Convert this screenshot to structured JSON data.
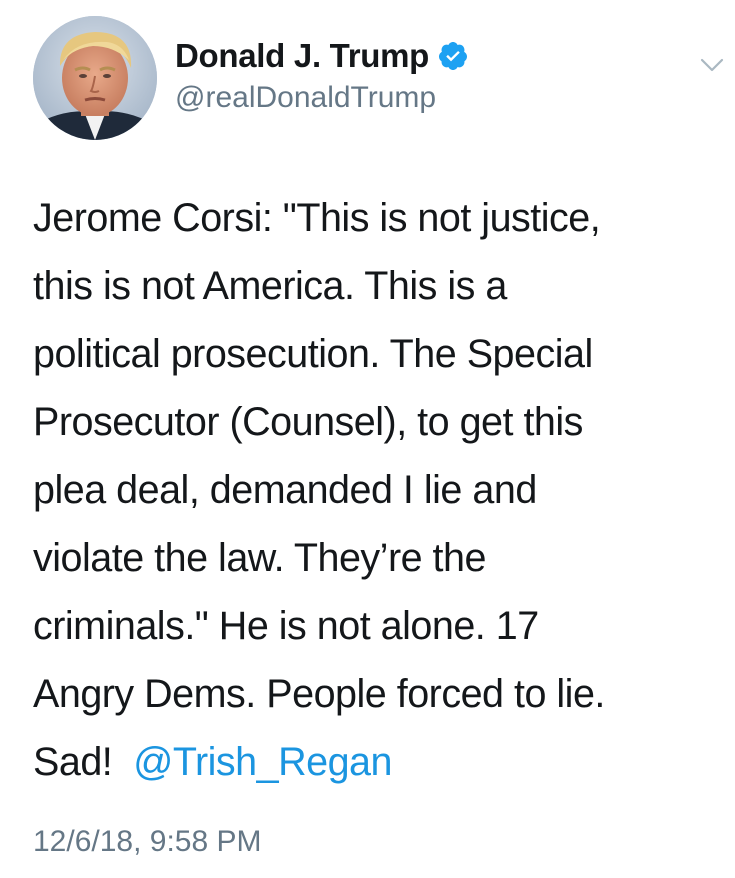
{
  "author": {
    "display_name": "Donald J. Trump",
    "handle": "@realDonaldTrump",
    "verified": true,
    "avatar_icon": "profile-photo"
  },
  "tweet": {
    "lines": [
      "Jerome Corsi: \"This is not justice,",
      "this is not America. This is a",
      "political prosecution. The Special",
      "Prosecutor (Counsel), to get this",
      "plea deal, demanded I lie and",
      "violate the law. They’re the",
      "criminals.\" He is not alone. 17",
      "Angry Dems. People forced to lie."
    ],
    "last_line_text": "Sad!",
    "mention": "@Trish_Regan",
    "timestamp": "12/6/18, 9:58 PM"
  },
  "colors": {
    "text": "#14171a",
    "secondary": "#657786",
    "link": "#1b95e0",
    "verified_badge": "#1da1f2"
  },
  "icons": {
    "verified": "verified-badge-icon",
    "menu": "chevron-down-icon"
  }
}
